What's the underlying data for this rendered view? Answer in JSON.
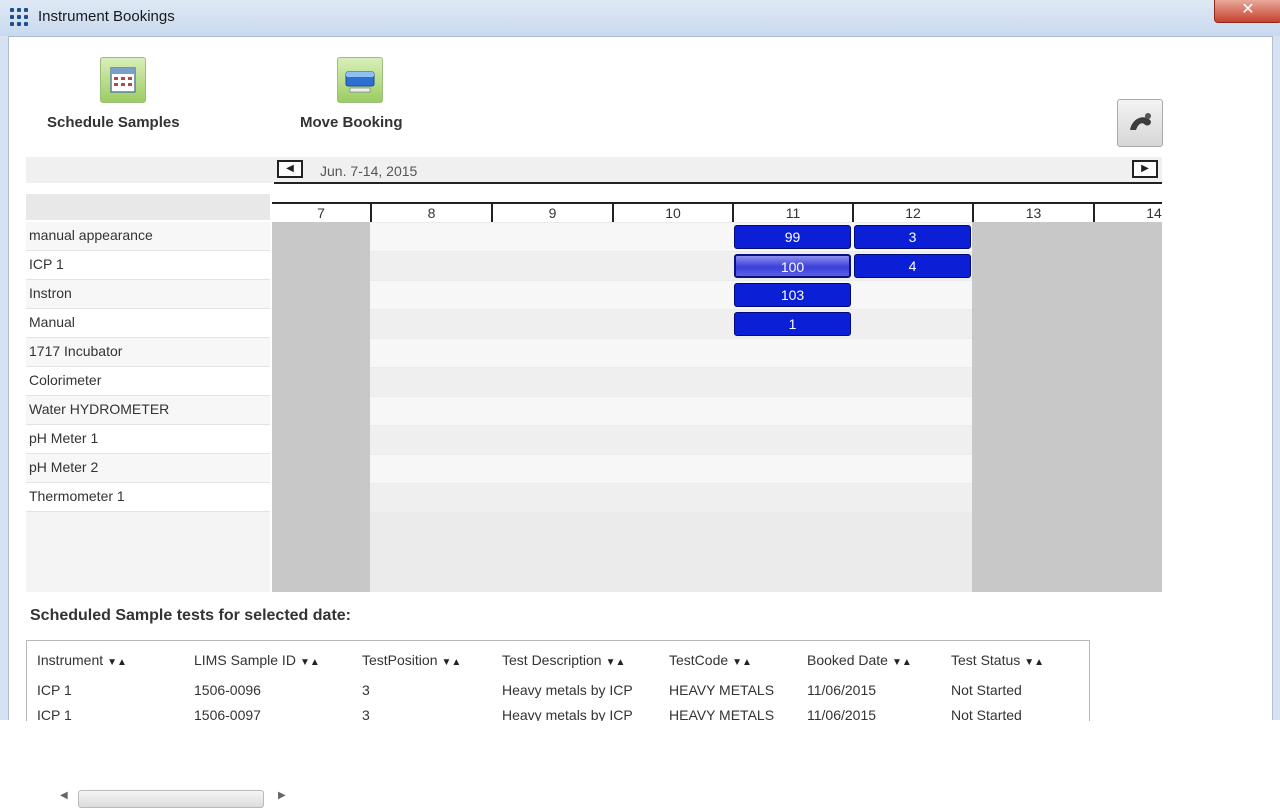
{
  "window": {
    "title": "Instrument Bookings",
    "close_label": "✕"
  },
  "toolbar": {
    "schedule_label": "Schedule Samples",
    "move_label": "Move Booking"
  },
  "scheduler": {
    "prev_label": "◀",
    "next_label": "▶",
    "date_range": "Jun. 7-14, 2015",
    "days": [
      "7",
      "8",
      "9",
      "10",
      "11",
      "12",
      "13",
      "14"
    ],
    "weekend_days": [
      "7",
      "13",
      "14"
    ],
    "resources": [
      "manual appearance",
      "ICP 1",
      "Instron",
      "Manual",
      "1717 Incubator",
      "Colorimeter",
      "Water HYDROMETER",
      "pH Meter 1",
      "pH Meter 2",
      "Thermometer 1"
    ],
    "bookings": [
      {
        "resource": 0,
        "day": "11",
        "label": "99"
      },
      {
        "resource": 0,
        "day": "12",
        "label": "3"
      },
      {
        "resource": 1,
        "day": "11",
        "label": "100",
        "selected": true
      },
      {
        "resource": 1,
        "day": "12",
        "label": "4"
      },
      {
        "resource": 2,
        "day": "11",
        "label": "103"
      },
      {
        "resource": 3,
        "day": "11",
        "label": "1"
      }
    ],
    "booking_color": "#0a1fd6",
    "weekend_color": "#c8c8c8"
  },
  "table": {
    "title": "Scheduled Sample tests for selected date:",
    "sort_indicator": "▼▲",
    "columns": [
      "Instrument",
      "LIMS Sample ID",
      "TestPosition",
      "Test Description",
      "TestCode",
      "Booked Date",
      "Test Status"
    ],
    "rows": [
      [
        "ICP 1",
        "1506-0096",
        "3",
        "Heavy metals by ICP",
        "HEAVY METALS",
        "11/06/2015",
        "Not Started"
      ],
      [
        "ICP 1",
        "1506-0097",
        "3",
        "Heavy metals by ICP",
        "HEAVY METALS",
        "11/06/2015",
        "Not Started"
      ]
    ]
  }
}
